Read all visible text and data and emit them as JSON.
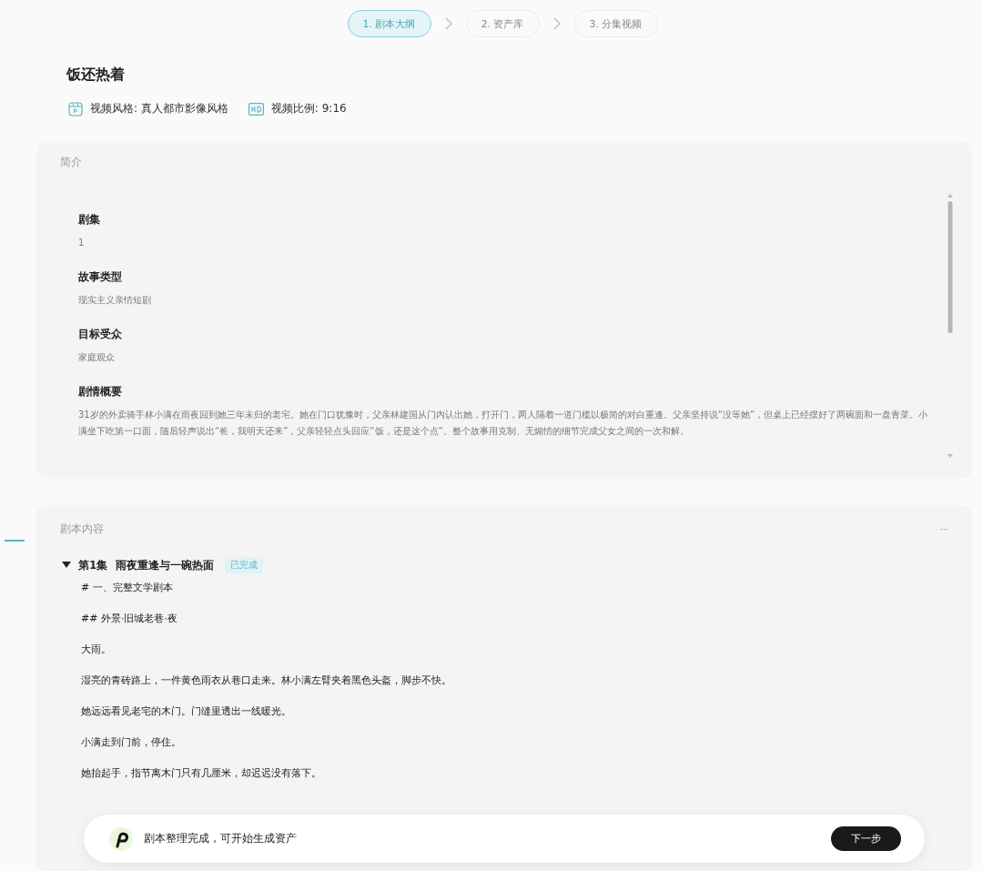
{
  "steps": [
    {
      "label": "1. 剧本大纲",
      "selected": true
    },
    {
      "label": "2. 资产库",
      "selected": false
    },
    {
      "label": "3. 分集视频",
      "selected": false
    }
  ],
  "title": "饭还热着",
  "meta": [
    {
      "kind": "style",
      "text": "视频风格: 真人都市影像风格"
    },
    {
      "kind": "ratio",
      "text": "视频比例: 9:16"
    }
  ],
  "intro": {
    "heading": "简介",
    "fields": [
      {
        "label": "剧集",
        "value": "1"
      },
      {
        "label": "故事类型",
        "value": "现实主义亲情短剧"
      },
      {
        "label": "目标受众",
        "value": "家庭观众"
      },
      {
        "label": "剧情概要",
        "value": "31岁的外卖骑手林小满在雨夜回到她三年未归的老宅。她在门口犹豫时，父亲林建国从门内认出她，打开门，两人隔着一道门槛以极简的对白重逢。父亲坚持说“没等她”，但桌上已经摆好了两碗面和一盘青菜。小满坐下吃第一口面，随后轻声说出“爸，我明天还来”，父亲轻轻点头回应“饭，还是这个点”。整个故事用克制、无煽情的细节完成父女之间的一次和解。"
      }
    ]
  },
  "script": {
    "heading": "剧本内容",
    "more": "···",
    "episodes": [
      {
        "title": "第1集  雨夜重逢与一碗热面",
        "status": "已完成",
        "expanded": true,
        "lines": [
          "# 一、完整文学剧本",
          "## 外景·旧城老巷·夜",
          "大雨。",
          "湿亮的青砖路上，一件黄色雨衣从巷口走来。林小满左臂夹着黑色头盔，脚步不快。",
          "她远远看见老宅的木门。门缝里透出一线暖光。",
          "小满走到门前，停住。",
          "她抬起手，指节离木门只有几厘米，却迟迟没有落下。"
        ]
      }
    ]
  },
  "toast": {
    "message": "剧本整理完成，可开始生成资产",
    "action": "下一步"
  }
}
